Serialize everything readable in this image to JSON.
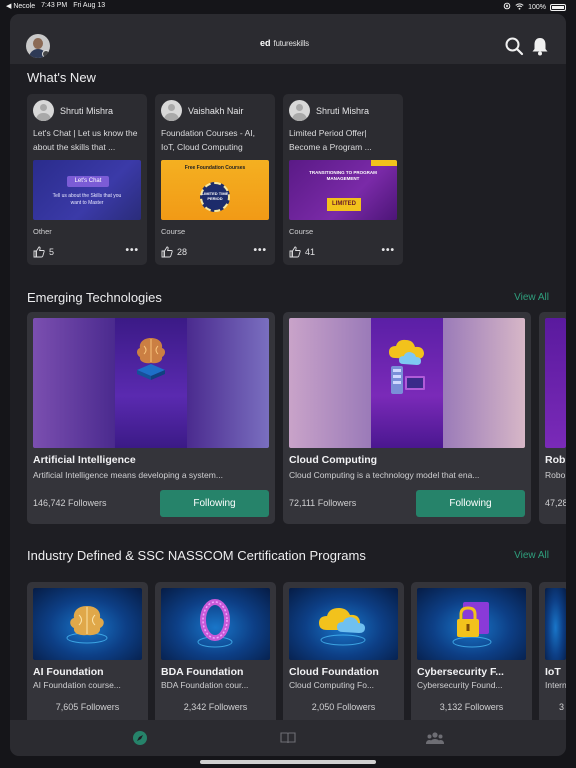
{
  "status_bar": {
    "back_app": "◀ Necole",
    "time": "7:43 PM",
    "date": "Fri Aug 13",
    "battery": "100%"
  },
  "header": {
    "logo_ed": "ed",
    "logo_text": "futureskills"
  },
  "whats_new": {
    "title": "What's New",
    "cards": [
      {
        "author": "Shruti Mishra",
        "text": "Let's Chat | Let us know the about the skills that ...",
        "image_title": "Let's Chat",
        "image_text": "Tell us about the Skills that you want to Master",
        "category": "Other",
        "likes": "5"
      },
      {
        "author": "Vaishakh Nair",
        "text": "Foundation Courses - AI, IoT, Cloud Computing",
        "image_title": "Free Foundation Courses",
        "image_text": "LIMITED TIME PERIOD",
        "category": "Course",
        "likes": "28"
      },
      {
        "author": "Shruti Mishra",
        "text": "Limited Period Offer| Become a Program ...",
        "image_title": "TRANSITIONING TO PROGRAM MANAGEMENT",
        "image_text": "LIMITED",
        "category": "Course",
        "likes": "41"
      }
    ]
  },
  "emerging": {
    "title": "Emerging Technologies",
    "view_all": "View All",
    "cards": [
      {
        "title": "Artificial Intelligence",
        "desc": "Artificial Intelligence means developing a system...",
        "followers": "146,742 Followers",
        "button": "Following"
      },
      {
        "title": "Cloud Computing",
        "desc": "Cloud Computing is a technology model that ena...",
        "followers": "72,111 Followers",
        "button": "Following"
      },
      {
        "title": "Rob",
        "desc": "Robo",
        "followers": "47,28"
      }
    ]
  },
  "certs": {
    "title": "Industry Defined & SSC NASSCOM Certification Programs",
    "view_all": "View All",
    "cards": [
      {
        "title": "AI Foundation",
        "desc": "AI Foundation course...",
        "followers": "7,605 Followers"
      },
      {
        "title": "BDA Foundation",
        "desc": "BDA Foundation cour...",
        "followers": "2,342 Followers"
      },
      {
        "title": "Cloud Foundation",
        "desc": "Cloud Computing Fo...",
        "followers": "2,050 Followers"
      },
      {
        "title": "Cybersecurity F...",
        "desc": "Cybersecurity Found...",
        "followers": "3,132 Followers"
      },
      {
        "title": "IoT",
        "desc": "Intern",
        "followers": "3"
      }
    ]
  },
  "tabs": [
    {
      "icon": "compass-icon",
      "active": true
    },
    {
      "icon": "book-icon",
      "active": false
    },
    {
      "icon": "community-icon",
      "active": false
    }
  ],
  "colors": {
    "accent": "#26836a",
    "view_all": "#2f9f7d",
    "panel": "#34343a",
    "background": "#1e1e23"
  }
}
